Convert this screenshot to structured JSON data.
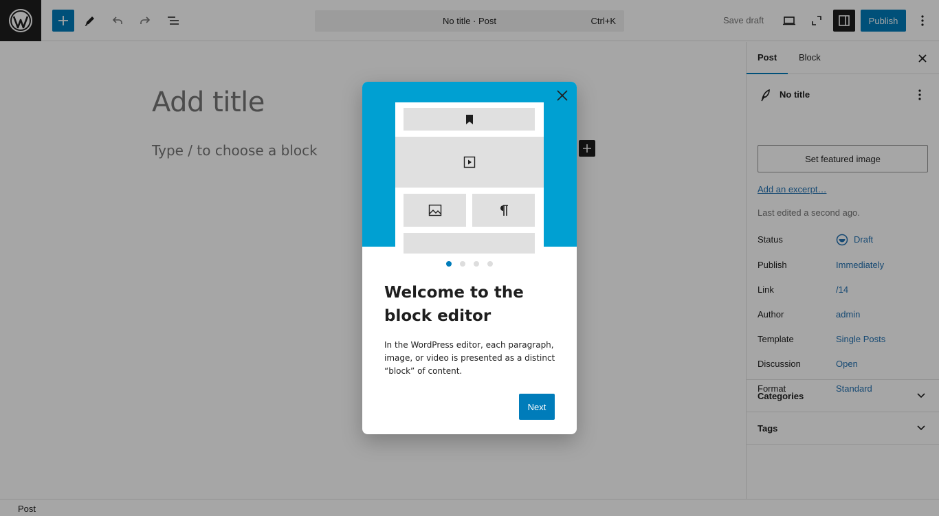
{
  "toolbar": {
    "logo_icon": "wordpress-icon",
    "add_block_icon": "plus-icon",
    "tools_icon": "pencil-icon",
    "undo_icon": "undo-icon",
    "redo_icon": "redo-icon",
    "outline_icon": "list-view-icon",
    "command_bar_title": "No title · Post",
    "command_bar_shortcut": "Ctrl+K",
    "save_draft_label": "Save draft",
    "preview_icon": "desktop-icon",
    "fullscreen_icon": "fullscreen-icon",
    "settings_icon": "sidebar-icon",
    "publish_label": "Publish",
    "options_icon": "more-vertical-icon",
    "accent_color": "#007cba"
  },
  "canvas": {
    "title_placeholder": "Add title",
    "paragraph_placeholder": "Type / to choose a block"
  },
  "sidebar": {
    "tabs": [
      {
        "label": "Post",
        "active": true
      },
      {
        "label": "Block",
        "active": false
      }
    ],
    "post_title": "No title",
    "featured_image_label": "Set featured image",
    "excerpt_link": "Add an excerpt…",
    "last_edited": "Last edited a second ago.",
    "meta": [
      {
        "label": "Status",
        "value": "Draft"
      },
      {
        "label": "Publish",
        "value": "Immediately"
      },
      {
        "label": "Link",
        "value": "/14"
      },
      {
        "label": "Author",
        "value": "admin"
      },
      {
        "label": "Template",
        "value": "Single Posts"
      },
      {
        "label": "Discussion",
        "value": "Open"
      },
      {
        "label": "Format",
        "value": "Standard"
      }
    ],
    "panels": [
      {
        "label": "Categories"
      },
      {
        "label": "Tags"
      }
    ]
  },
  "footer": {
    "breadcrumb": "Post"
  },
  "modal": {
    "hero_color": "#00a0d2",
    "hero_icons": [
      "bookmark-icon",
      "video-icon",
      "image-icon",
      "paragraph-icon"
    ],
    "page_count": 4,
    "current_page": 1,
    "heading": "Welcome to the block editor",
    "body": "In the WordPress editor, each paragraph, image, or video is presented as a distinct “block” of content.",
    "next_label": "Next"
  }
}
